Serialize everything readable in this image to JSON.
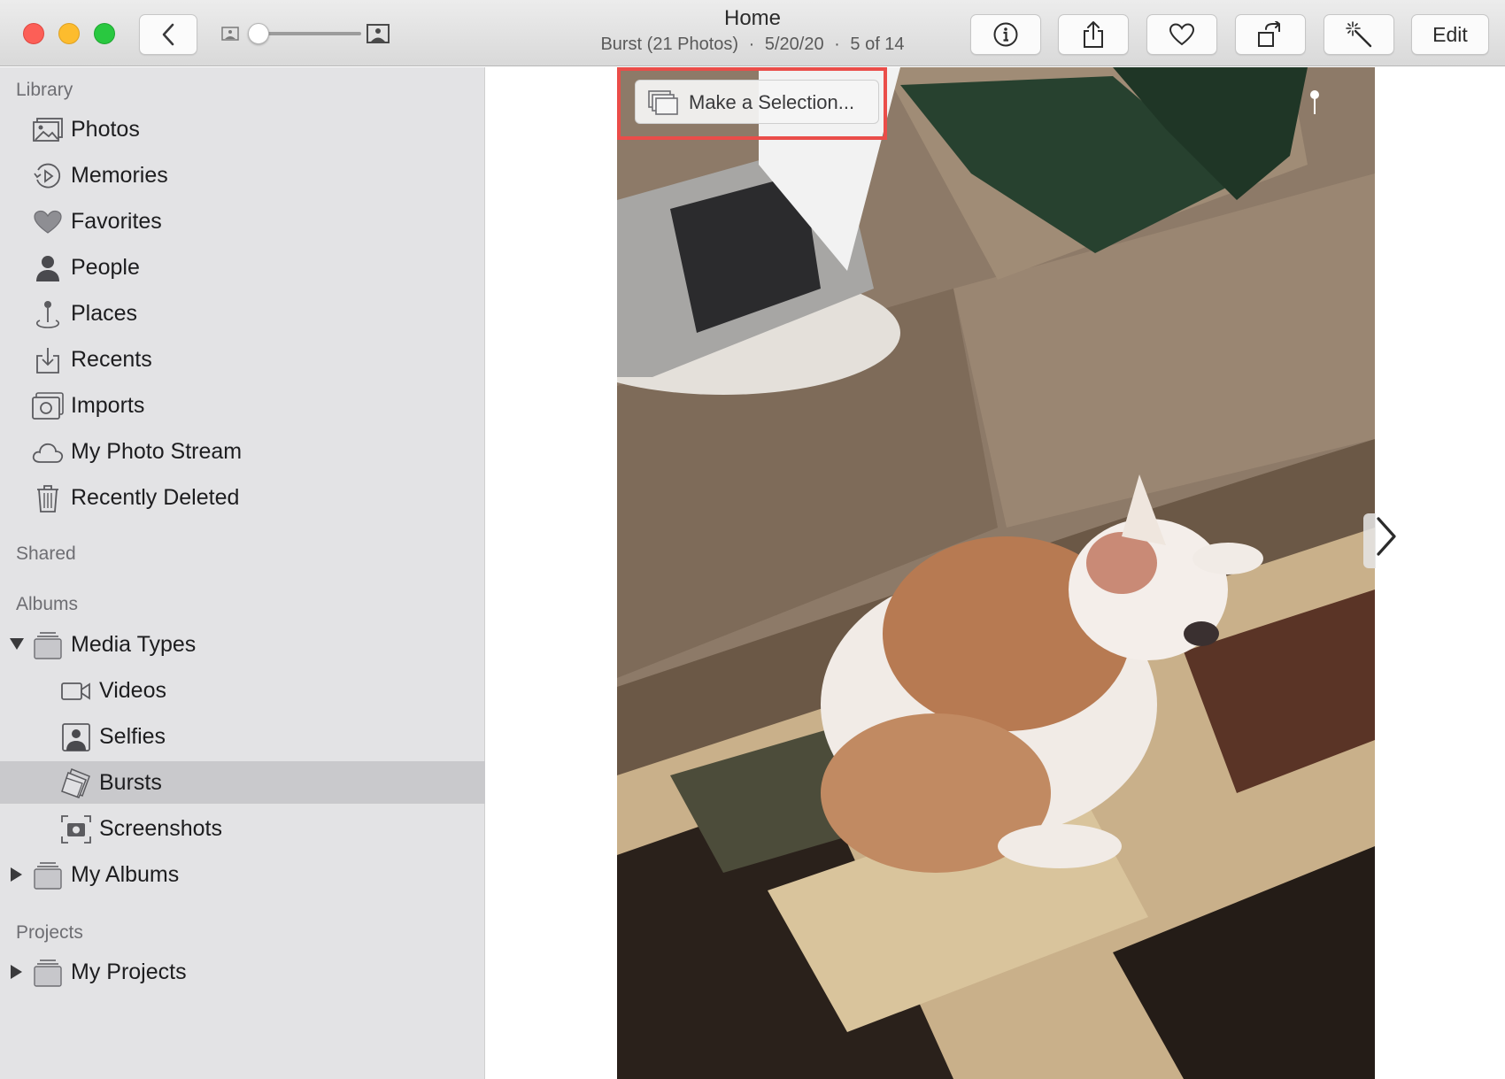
{
  "window": {
    "title": "Home",
    "subtitle": {
      "burst": "Burst (21 Photos)",
      "separator1": "·",
      "date": "5/20/20",
      "separator2": "·",
      "position": "5 of 14"
    }
  },
  "toolbar": {
    "edit_label": "Edit",
    "zoom_fraction": 0.0
  },
  "sidebar": {
    "library_header": "Library",
    "library_items": [
      {
        "label": "Photos",
        "icon": "photos-icon"
      },
      {
        "label": "Memories",
        "icon": "memories-icon"
      },
      {
        "label": "Favorites",
        "icon": "heart-icon"
      },
      {
        "label": "People",
        "icon": "person-icon"
      },
      {
        "label": "Places",
        "icon": "map-pin-icon"
      },
      {
        "label": "Recents",
        "icon": "tray-download-icon"
      },
      {
        "label": "Imports",
        "icon": "camera-icon"
      },
      {
        "label": "My Photo Stream",
        "icon": "cloud-icon"
      },
      {
        "label": "Recently Deleted",
        "icon": "trash-icon"
      }
    ],
    "shared_header": "Shared",
    "albums_header": "Albums",
    "media_types": {
      "label": "Media Types",
      "expanded": true,
      "children": [
        {
          "label": "Videos",
          "icon": "video-camera-icon"
        },
        {
          "label": "Selfies",
          "icon": "selfie-icon"
        },
        {
          "label": "Bursts",
          "icon": "bursts-icon",
          "selected": true
        },
        {
          "label": "Screenshots",
          "icon": "screenshot-icon"
        }
      ]
    },
    "my_albums": {
      "label": "My Albums",
      "expanded": false
    },
    "projects_header": "Projects",
    "my_projects": {
      "label": "My Projects",
      "expanded": false
    }
  },
  "viewer": {
    "make_selection_label": "Make a Selection...",
    "highlight_color": "#ea4d49"
  },
  "colors": {
    "sidebar_bg": "#e3e3e5",
    "selected_row": "#c9c9cc",
    "close": "#fc5f57",
    "minimize": "#fdbc2e",
    "zoom": "#29c840"
  }
}
